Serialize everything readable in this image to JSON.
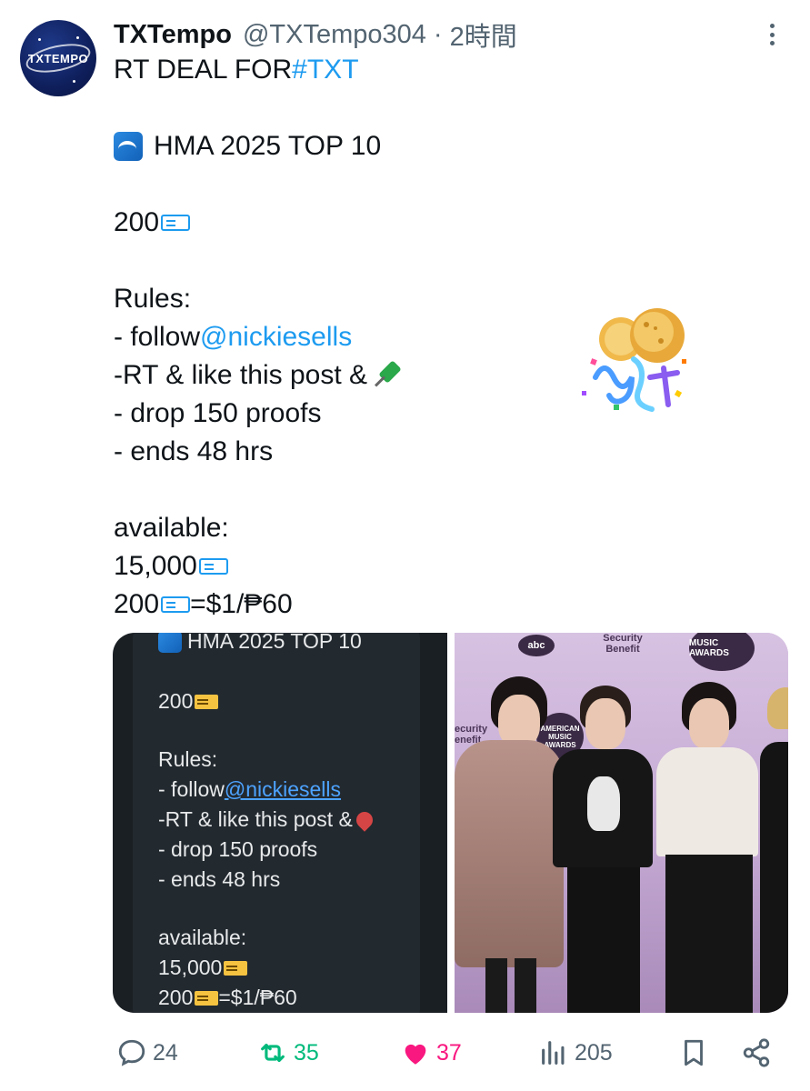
{
  "tweet": {
    "author_name": "TXTempo",
    "handle": "@TXTempo304",
    "separator": "·",
    "time": "2時間",
    "avatar_text": "TXTEMPO",
    "text_lines": {
      "l1_prefix": "RT DEAL FOR ",
      "l1_hashtag": "#TXT",
      "l3": "HMA 2025 TOP 10",
      "l5": "200",
      "l7": "Rules:",
      "l8_prefix": "- follow ",
      "l8_mention": "@nickiesells",
      "l9": "-RT & like this post &",
      "l10": "- drop 150 proofs",
      "l11": "- ends 48 hrs",
      "l13": "available:",
      "l14": "15,000",
      "l15_a": "200",
      "l15_b": "=$1/₱60"
    }
  },
  "media_screenshot": {
    "title": "HMA 2025 TOP 10",
    "count": "200",
    "rules": "Rules:",
    "follow_prefix": "- follow ",
    "follow_mention": "@nickiesells",
    "rt_like": "-RT & like this post &",
    "drop": "- drop 150 proofs",
    "ends": "- ends 48 hrs",
    "available": "available:",
    "total": "15,000",
    "rate_a": "200",
    "rate_b": "=$1/₱60"
  },
  "media_photo": {
    "wall_1": "abc",
    "wall_2": "Security Benefit",
    "wall_3": "MUSIC AWARDS",
    "wall_4": "AMERICAN MUSIC AWARDS",
    "wall_5": "ecurity enefit"
  },
  "actions": {
    "replies": "24",
    "retweets": "35",
    "likes": "37",
    "views": "205"
  },
  "colors": {
    "link": "#1d9bf0",
    "retweet": "#00ba7c",
    "like": "#f91880",
    "muted": "#536471"
  }
}
